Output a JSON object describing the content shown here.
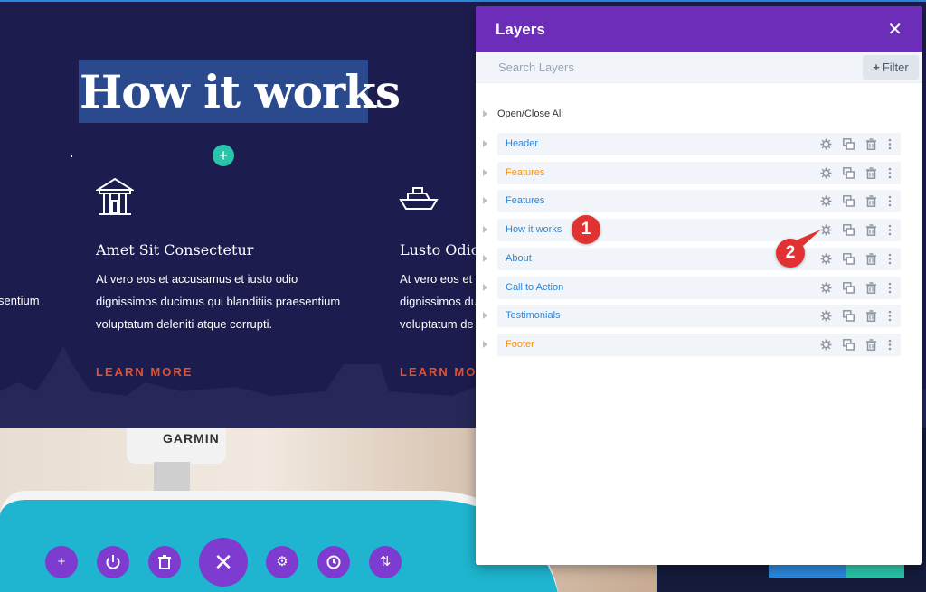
{
  "page": {
    "heading": "How it works",
    "columns": [
      {
        "title": "Amet Sit Consectetur",
        "lines": [
          "At vero eos et accusamus et iusto odio",
          "dignissimos ducimus qui blanditiis praesentium",
          "voluptatum deleniti atque corrupti."
        ],
        "link": "LEARN MORE",
        "icon": "building-icon"
      },
      {
        "title": "Lusto Odio",
        "lines": [
          "At vero eos et a",
          "dignissimos du",
          "voluptatum de"
        ],
        "link": "LEARN MO",
        "icon": "ship-icon"
      }
    ],
    "left_cut_text": "sentium",
    "photo_brand_text": "GARMIN"
  },
  "builder_bar": {
    "buttons": [
      "add-icon",
      "power-icon",
      "trash-icon",
      "close-icon",
      "gear-icon",
      "history-icon",
      "sort-icon"
    ]
  },
  "layers_panel": {
    "title": "Layers",
    "search_placeholder": "Search Layers",
    "filter_label": "Filter",
    "open_close_label": "Open/Close All",
    "items": [
      {
        "label": "Header",
        "color": "#2b87da"
      },
      {
        "label": "Features",
        "color": "#f5941b"
      },
      {
        "label": "Features",
        "color": "#2b87da"
      },
      {
        "label": "How it works",
        "color": "#2b87da"
      },
      {
        "label": "About",
        "color": "#2b87da"
      },
      {
        "label": "Call to Action",
        "color": "#2b87da"
      },
      {
        "label": "Testimonials",
        "color": "#2b87da"
      },
      {
        "label": "Footer",
        "color": "#f5941b"
      }
    ],
    "accent_color": "#6c2eb9"
  },
  "annotations": [
    {
      "label": "1"
    },
    {
      "label": "2"
    }
  ]
}
